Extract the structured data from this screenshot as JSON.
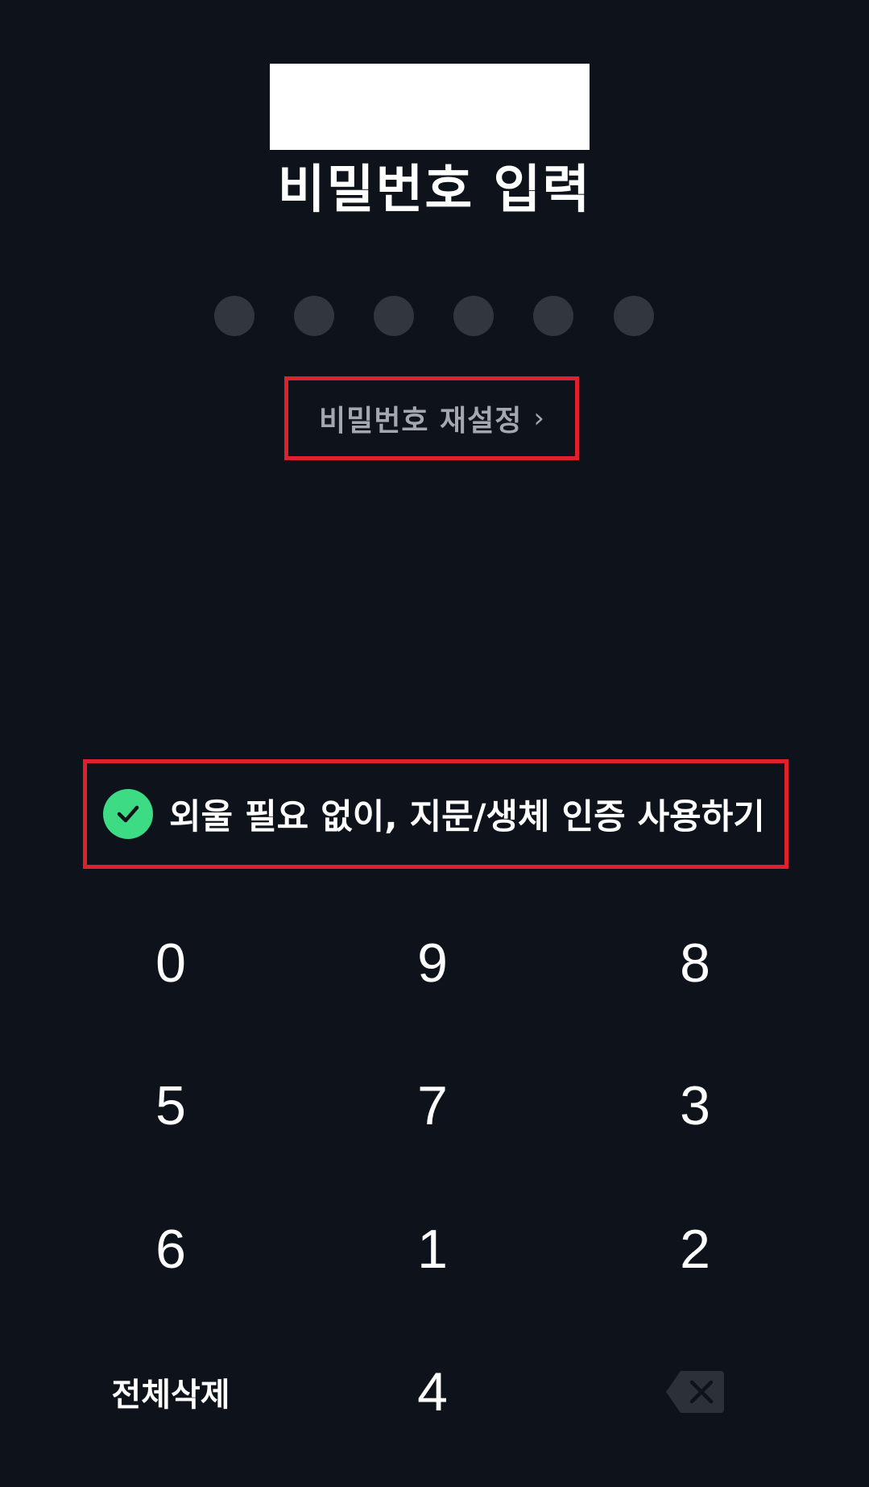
{
  "screen": {
    "title": "비밀번호 입력",
    "pin_length": 6,
    "pin_filled": 0
  },
  "reset": {
    "label": "비밀번호 재설정",
    "chevron": "›"
  },
  "biometric": {
    "label": "외울 필요 없이, 지문/생체 인증 사용하기",
    "checked": true,
    "icon": "check-icon"
  },
  "keypad": {
    "rows": [
      [
        "0",
        "9",
        "8"
      ],
      [
        "5",
        "7",
        "3"
      ],
      [
        "6",
        "1",
        "2"
      ]
    ],
    "clear_all_label": "전체삭제",
    "last_digit": "4",
    "backspace_icon": "backspace-icon"
  },
  "colors": {
    "background": "#0e131b",
    "dot_empty": "#31363f",
    "check": "#3ddc84",
    "highlight_border": "#e0202a",
    "muted_text": "#a4a8ae"
  }
}
